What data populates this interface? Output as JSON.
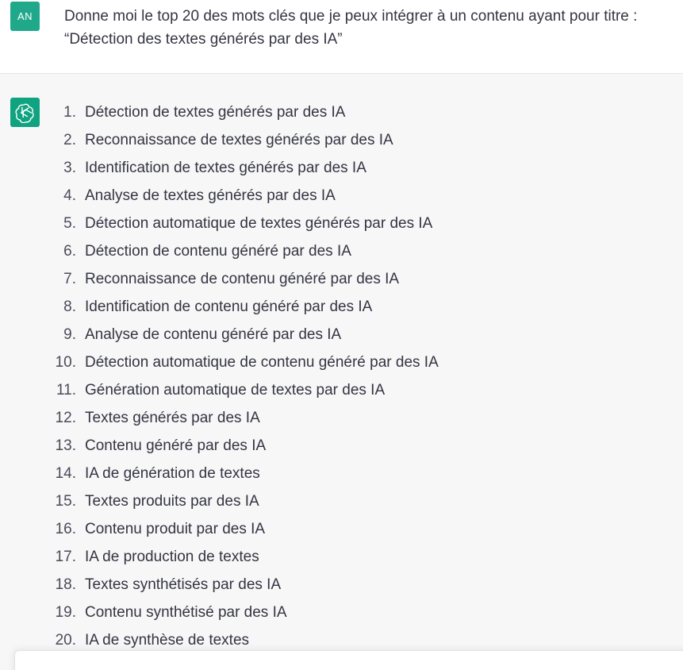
{
  "user": {
    "avatar_initials": "AN",
    "message": "Donne moi le top 20 des mots clés que je peux intégrer à un contenu ayant pour titre : “Détection des textes générés par des IA”"
  },
  "assistant": {
    "avatar_icon": "openai-logo-icon",
    "items": [
      {
        "num": "1.",
        "text": "Détection de textes générés par des IA"
      },
      {
        "num": "2.",
        "text": "Reconnaissance de textes générés par des IA"
      },
      {
        "num": "3.",
        "text": "Identification de textes générés par des IA"
      },
      {
        "num": "4.",
        "text": "Analyse de textes générés par des IA"
      },
      {
        "num": "5.",
        "text": "Détection automatique de textes générés par des IA"
      },
      {
        "num": "6.",
        "text": "Détection de contenu généré par des IA"
      },
      {
        "num": "7.",
        "text": "Reconnaissance de contenu généré par des IA"
      },
      {
        "num": "8.",
        "text": "Identification de contenu généré par des IA"
      },
      {
        "num": "9.",
        "text": "Analyse de contenu généré par des IA"
      },
      {
        "num": "10.",
        "text": "Détection automatique de contenu généré par des IA"
      },
      {
        "num": "11.",
        "text": "Génération automatique de textes par des IA"
      },
      {
        "num": "12.",
        "text": "Textes générés par des IA"
      },
      {
        "num": "13.",
        "text": "Contenu généré par des IA"
      },
      {
        "num": "14.",
        "text": "IA de génération de textes"
      },
      {
        "num": "15.",
        "text": "Textes produits par des IA"
      },
      {
        "num": "16.",
        "text": "Contenu produit par des IA"
      },
      {
        "num": "17.",
        "text": "IA de production de textes"
      },
      {
        "num": "18.",
        "text": "Textes synthétisés par des IA"
      },
      {
        "num": "19.",
        "text": "Contenu synthétisé par des IA"
      },
      {
        "num": "20.",
        "text": "IA de synthèse de textes"
      }
    ]
  },
  "colors": {
    "user_avatar": "#1fa98a",
    "bot_avatar": "#10a37f",
    "assistant_bg": "#f7f7f8",
    "text": "#343541"
  }
}
